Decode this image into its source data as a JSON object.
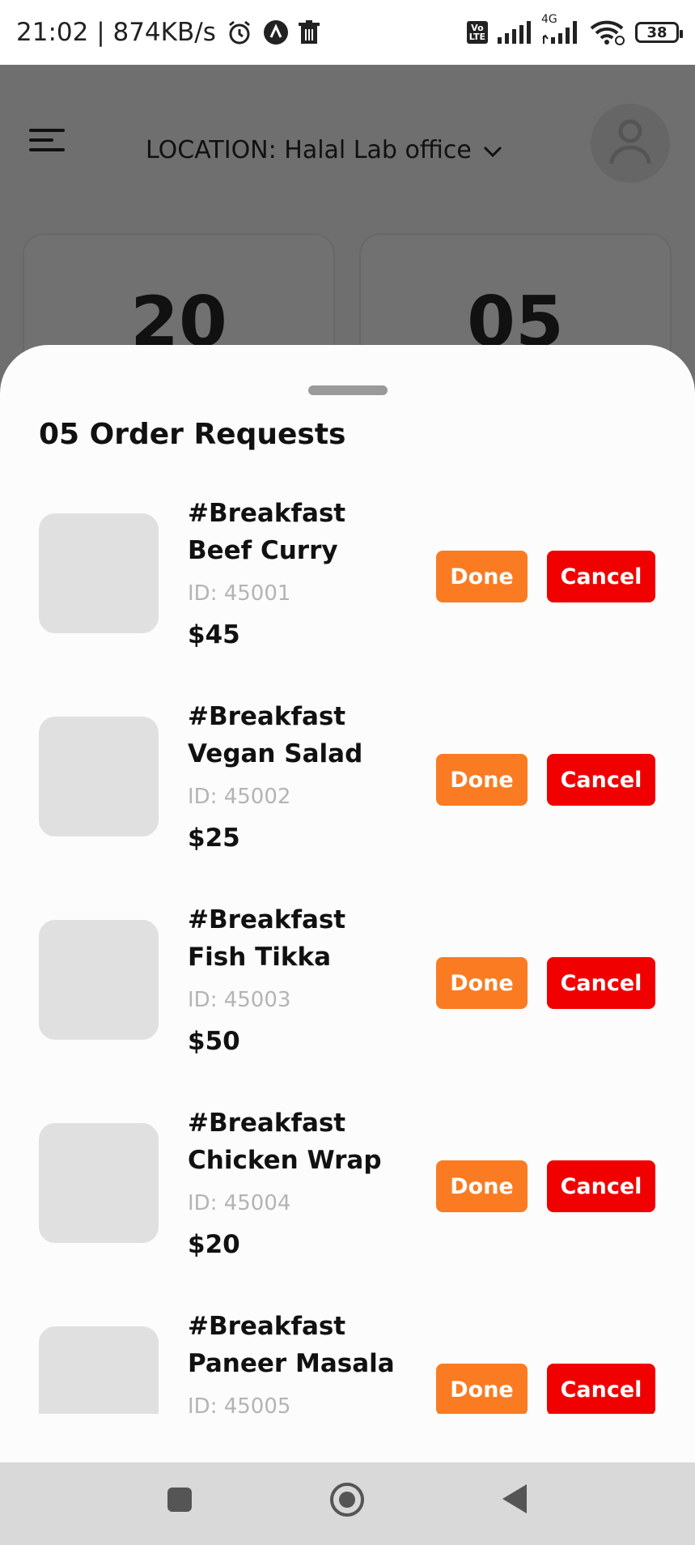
{
  "status_bar": {
    "time_speed": "21:02 | 874KB/s",
    "network_label": "4G",
    "volte_label": "Vo\nLTE",
    "battery": "38"
  },
  "header": {
    "location_label": "LOCATION: Halal Lab office"
  },
  "stats": [
    {
      "value": "20"
    },
    {
      "value": "05"
    }
  ],
  "sheet": {
    "title": "05 Order Requests",
    "orders": [
      {
        "tag": "#Breakfast",
        "name": "Beef Curry",
        "id": "ID: 45001",
        "price": "$45",
        "done_label": "Done",
        "cancel_label": "Cancel"
      },
      {
        "tag": "#Breakfast",
        "name": "Vegan Salad",
        "id": "ID: 45002",
        "price": "$25",
        "done_label": "Done",
        "cancel_label": "Cancel"
      },
      {
        "tag": "#Breakfast",
        "name": "Fish Tikka",
        "id": "ID: 45003",
        "price": "$50",
        "done_label": "Done",
        "cancel_label": "Cancel"
      },
      {
        "tag": "#Breakfast",
        "name": "Chicken Wrap",
        "id": "ID: 45004",
        "price": "$20",
        "done_label": "Done",
        "cancel_label": "Cancel"
      },
      {
        "tag": "#Breakfast",
        "name": "Paneer Masala",
        "id": "ID: 45005",
        "price": "",
        "done_label": "Done",
        "cancel_label": "Cancel"
      }
    ]
  },
  "colors": {
    "done_button": "#fb7b22",
    "cancel_button": "#f10000",
    "dim_overlay": "#6f6f6f"
  },
  "icons": [
    "alarm-icon",
    "app-icon",
    "trash-icon",
    "signal-icon",
    "wifi-icon",
    "menu-icon",
    "chevron-down-icon",
    "user-icon",
    "nav-recents-icon",
    "nav-home-icon",
    "nav-back-icon"
  ]
}
